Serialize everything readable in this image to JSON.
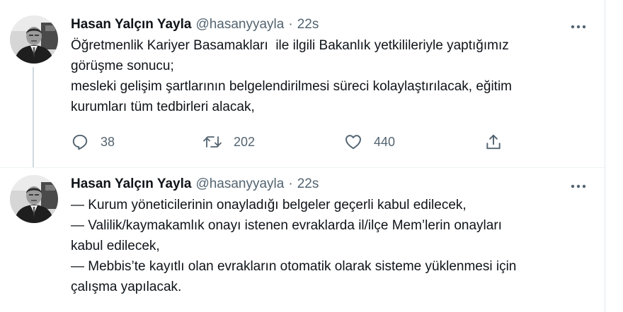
{
  "colors": {
    "text": "#0f1419",
    "secondary": "#536471",
    "thread_line": "#cfd9de"
  },
  "tweets": [
    {
      "author": {
        "name": "Hasan Yalçın Yayla",
        "handle": "@hasanyyayla",
        "separator": "·",
        "time": "22s"
      },
      "lines": [
        "Öğretmenlik Kariyer Basamakları  ile ilgili Bakanlık yetkilileriyle yaptığımız",
        "görüşme sonucu;",
        "mesleki gelişim şartlarının belgelendirilmesi süreci kolaylaştırılacak, eğitim",
        "kurumları tüm tedbirleri alacak,"
      ],
      "actions": {
        "reply_icon": "reply-icon",
        "reply_count": "38",
        "retweet_icon": "retweet-icon",
        "retweet_count": "202",
        "like_icon": "like-icon",
        "like_count": "440",
        "share_icon": "share-icon"
      },
      "more_icon": "more-options-icon"
    },
    {
      "author": {
        "name": "Hasan Yalçın Yayla",
        "handle": "@hasanyyayla",
        "separator": "·",
        "time": "22s"
      },
      "lines": [
        "— Kurum yöneticilerinin onayladığı belgeler geçerli kabul edilecek,",
        "— Valilik/kaymakamlık onayı istenen evraklarda il/ilçe Mem’lerin onayları",
        "kabul edilecek,",
        "— Mebbis’te kayıtlı olan evrakların otomatik olarak sisteme yüklenmesi için",
        "çalışma yapılacak."
      ],
      "more_icon": "more-options-icon"
    }
  ]
}
